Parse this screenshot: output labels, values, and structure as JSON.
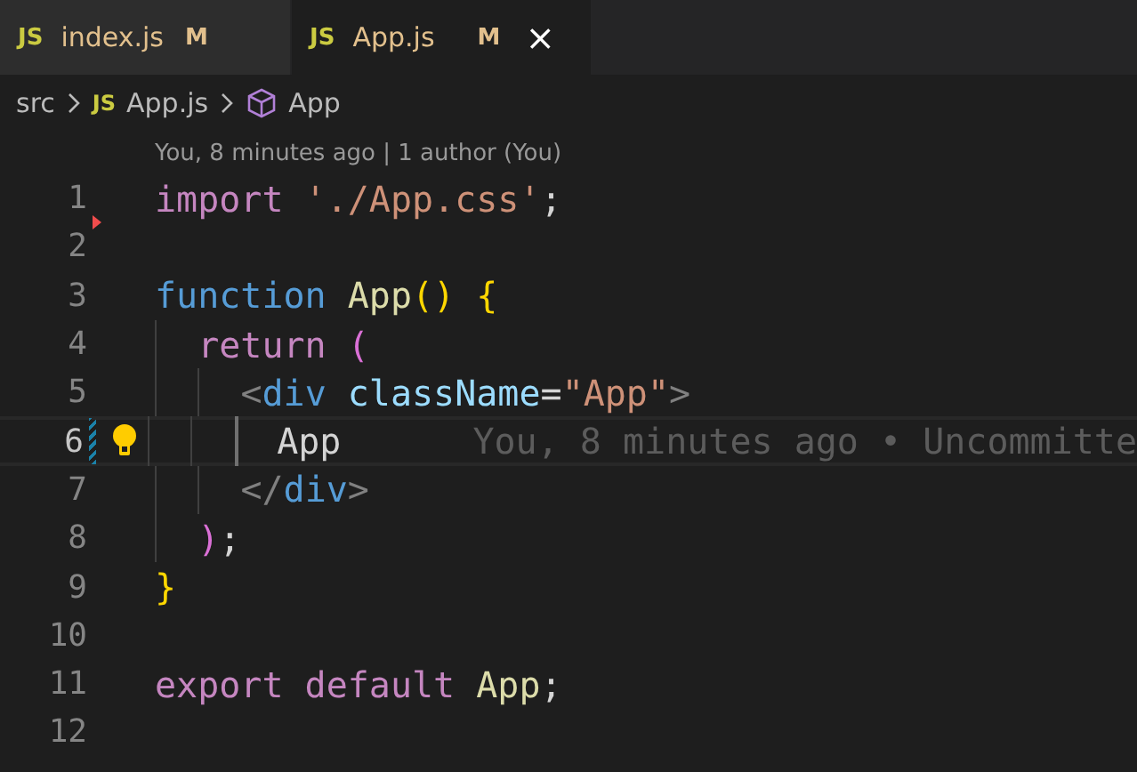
{
  "tabs": [
    {
      "icon": "JS",
      "label": "index.js",
      "badge": "M",
      "selected": false
    },
    {
      "icon": "JS",
      "label": "App.js",
      "badge": "M",
      "selected": true,
      "close": "×"
    }
  ],
  "breadcrumb": [
    {
      "kind": "folder",
      "label": "src"
    },
    {
      "kind": "file",
      "icon": "JS",
      "label": "App.js"
    },
    {
      "kind": "symbol",
      "label": "App"
    }
  ],
  "codelens": "You, 8 minutes ago | 1 author (You)",
  "lines": [
    {
      "number": "1",
      "current": false,
      "deleted": true,
      "tokens": [
        {
          "kind": "keyword",
          "text": "import"
        },
        {
          "kind": "string",
          "text": "'./App.css'",
          "spaced": true
        },
        {
          "kind": "plain",
          "text": ";"
        }
      ]
    },
    {
      "number": "2",
      "current": false
    },
    {
      "number": "3",
      "current": false,
      "tokens": [
        {
          "kind": "storage",
          "text": "function"
        },
        {
          "kind": "func",
          "text": "App",
          "spaced": true
        },
        {
          "kind": "bracket1",
          "text": "()"
        },
        {
          "kind": "bracket1",
          "text": "{",
          "spaced": true
        }
      ]
    },
    {
      "number": "4",
      "current": false,
      "guides": [
        {
          "active": false
        }
      ],
      "tokens": [
        {
          "kind": "keyword",
          "text": "return"
        },
        {
          "kind": "bracket2",
          "text": "(",
          "spaced": true
        }
      ]
    },
    {
      "number": "5",
      "current": false,
      "guides": [
        {
          "active": false
        },
        {
          "active": false
        }
      ],
      "tokens": [
        {
          "kind": "tagpunct",
          "text": "<"
        },
        {
          "kind": "tag",
          "text": "div"
        },
        {
          "kind": "attr",
          "text": "className",
          "spaced": true
        },
        {
          "kind": "plain",
          "text": "="
        },
        {
          "kind": "string",
          "text": "\"App\""
        },
        {
          "kind": "tagpunct",
          "text": ">"
        }
      ]
    },
    {
      "number": "6",
      "current": true,
      "modified": true,
      "lightbulb": true,
      "guides": [
        {
          "active": false
        },
        {
          "active": false
        },
        {
          "active": true
        }
      ],
      "tokens": [
        {
          "kind": "plain",
          "text": "App"
        }
      ],
      "blame": "You, 8 minutes ago • Uncommitte"
    },
    {
      "number": "7",
      "current": false,
      "guides": [
        {
          "active": false
        },
        {
          "active": false
        }
      ],
      "tokens": [
        {
          "kind": "tagpunct",
          "text": "</"
        },
        {
          "kind": "tag",
          "text": "div"
        },
        {
          "kind": "tagpunct",
          "text": ">"
        }
      ]
    },
    {
      "number": "8",
      "current": false,
      "guides": [
        {
          "active": false
        }
      ],
      "tokens": [
        {
          "kind": "bracket2",
          "text": ")"
        },
        {
          "kind": "plain",
          "text": ";"
        }
      ]
    },
    {
      "number": "9",
      "current": false,
      "tokens": [
        {
          "kind": "bracket1",
          "text": "}"
        }
      ]
    },
    {
      "number": "10",
      "current": false
    },
    {
      "number": "11",
      "current": false,
      "tokens": [
        {
          "kind": "keyword",
          "text": "export"
        },
        {
          "kind": "keyword",
          "text": "default",
          "spaced": true
        },
        {
          "kind": "func",
          "text": "App",
          "spaced": true
        },
        {
          "kind": "plain",
          "text": ";"
        }
      ]
    },
    {
      "number": "12",
      "current": false
    }
  ]
}
